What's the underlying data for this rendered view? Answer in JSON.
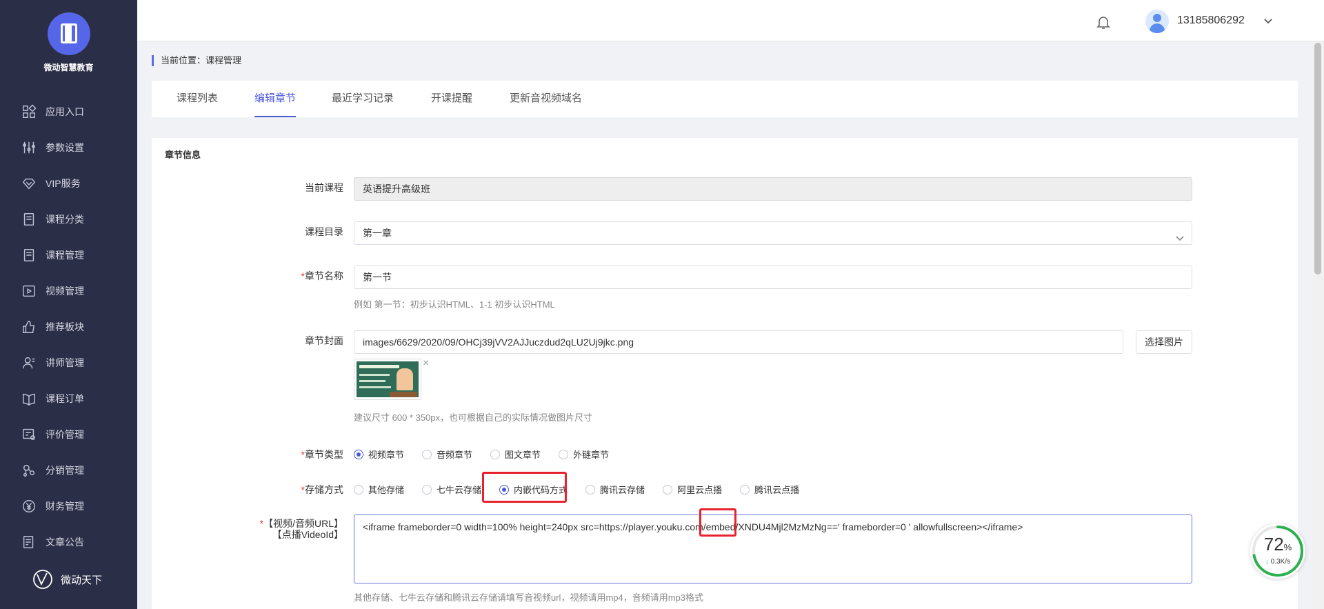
{
  "app": {
    "logo_title": "微动智慧教育",
    "brand_name": "微动天下"
  },
  "sidebar": {
    "items": [
      {
        "label": "应用入口",
        "icon": "grid-icon"
      },
      {
        "label": "参数设置",
        "icon": "sliders-icon"
      },
      {
        "label": "VIP服务",
        "icon": "diamond-icon"
      },
      {
        "label": "课程分类",
        "icon": "document-icon"
      },
      {
        "label": "课程管理",
        "icon": "document-icon"
      },
      {
        "label": "视频管理",
        "icon": "play-icon"
      },
      {
        "label": "推荐板块",
        "icon": "thumbs-up-icon"
      },
      {
        "label": "讲师管理",
        "icon": "user-icon"
      },
      {
        "label": "课程订单",
        "icon": "book-icon"
      },
      {
        "label": "评价管理",
        "icon": "review-icon"
      },
      {
        "label": "分销管理",
        "icon": "share-icon"
      },
      {
        "label": "财务管理",
        "icon": "yuan-icon"
      },
      {
        "label": "文章公告",
        "icon": "article-icon"
      }
    ]
  },
  "header": {
    "username": "13185806292"
  },
  "breadcrumb": {
    "text": "当前位置：课程管理"
  },
  "tabs": [
    {
      "label": "课程列表",
      "active": false
    },
    {
      "label": "编辑章节",
      "active": true
    },
    {
      "label": "最近学习记录",
      "active": false
    },
    {
      "label": "开课提醒",
      "active": false
    },
    {
      "label": "更新音视频域名",
      "active": false
    }
  ],
  "form": {
    "section_title": "章节信息",
    "current_course": {
      "label": "当前课程",
      "value": "英语提升高级班"
    },
    "course_dir": {
      "label": "课程目录",
      "value": "第一章"
    },
    "chapter_name": {
      "required_mark": "*",
      "label": "章节名称",
      "value": "第一节",
      "hint": "例如 第一节：初步认识HTML、1-1 初步认识HTML"
    },
    "cover": {
      "label": "章节封面",
      "value": "images/6629/2020/09/OHCj39jVV2AJJuczdud2qLU2Uj9jkc.png",
      "button": "选择图片",
      "remove": "×",
      "hint": "建议尺寸 600 * 350px，也可根据自己的实际情况做图片尺寸"
    },
    "chapter_type": {
      "required_mark": "*",
      "label": "章节类型",
      "options": [
        "视频章节",
        "音频章节",
        "图文章节",
        "外链章节"
      ],
      "selected": "视频章节"
    },
    "storage": {
      "required_mark": "*",
      "label": "存储方式",
      "options": [
        "其他存储",
        "七牛云存储",
        "内嵌代码方式",
        "腾讯云存储",
        "阿里云点播",
        "腾讯云点播"
      ],
      "selected": "内嵌代码方式"
    },
    "media_url": {
      "required_mark": "*",
      "label_line1": "【视频/音频URL】",
      "label_line2": "【点播VideoId】",
      "value": "<iframe  frameborder=0  width=100%  height=240px  src=https://player.youku.com/embed/XNDU4Mjl2MzMzNg==' frameborder=0 '  allowfullscreen></iframe>",
      "hint": "其他存储、七牛云存储和腾讯云存储请填写音视频url，视频请用mp4，音频请用mp3格式"
    }
  },
  "speed_widget": {
    "percent": "72",
    "unit": "%",
    "arrow": "↓",
    "rate": "0.3K/s",
    "level": 0.72
  },
  "colors": {
    "sidebar_bg": "#2b2e47",
    "accent": "#4a58d8",
    "highlight_box": "#e8222d",
    "speed_ring": "#2db14f"
  }
}
